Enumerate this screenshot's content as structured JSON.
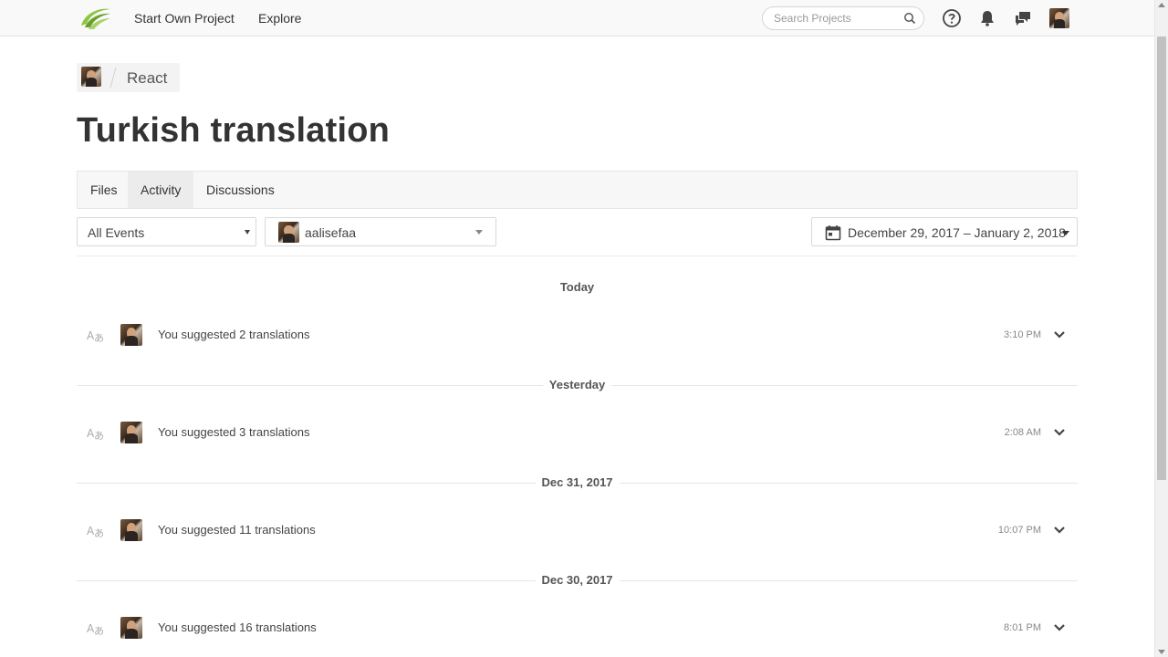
{
  "nav": {
    "links": [
      "Start Own Project",
      "Explore"
    ],
    "search_placeholder": "Search Projects",
    "icons": [
      "help-icon",
      "bell-icon",
      "messages-icon"
    ]
  },
  "breadcrumb": {
    "project": "React"
  },
  "page_title": "Turkish translation",
  "tabs": [
    {
      "label": "Files",
      "active": false
    },
    {
      "label": "Activity",
      "active": true
    },
    {
      "label": "Discussions",
      "active": false
    }
  ],
  "filters": {
    "events": "All Events",
    "user": "aalisefaa",
    "date_range": "December 29, 2017 – January 2, 2018"
  },
  "groups": [
    {
      "label": "Today",
      "event": {
        "text": "You suggested 2 translations",
        "time": "3:10 PM"
      }
    },
    {
      "label": "Yesterday",
      "event": {
        "text": "You suggested 3 translations",
        "time": "2:08 AM"
      }
    },
    {
      "label": "Dec 31, 2017",
      "event": {
        "text": "You suggested 11 translations",
        "time": "10:07 PM"
      }
    },
    {
      "label": "Dec 30, 2017",
      "event": {
        "text": "You suggested 16 translations",
        "time": "8:01 PM"
      }
    }
  ],
  "colors": {
    "logo_green": "#8cc63f",
    "text": "#333333",
    "muted": "#888888"
  }
}
